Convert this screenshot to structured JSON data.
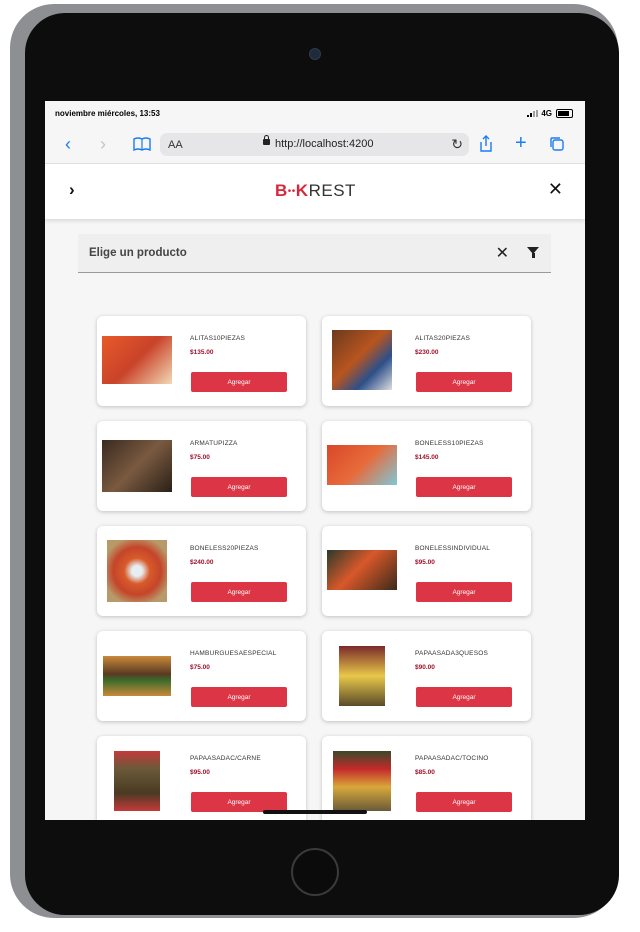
{
  "status": {
    "datetime": "noviembre miércoles, 13:53",
    "network": "4G"
  },
  "browser": {
    "text_size": "AA",
    "url": "http://localhost:4200"
  },
  "app": {
    "logo": {
      "b": "B",
      "dots": "••",
      "k": "K",
      "rest": "REST"
    },
    "search_placeholder": "Elige un producto"
  },
  "products": [
    {
      "name": "ALITAS10PIEZAS",
      "price": "$135.00",
      "button": "Agregar"
    },
    {
      "name": "ALITAS20PIEZAS",
      "price": "$230.00",
      "button": "Agregar"
    },
    {
      "name": "ARMATUPIZZA",
      "price": "$75.00",
      "button": "Agregar"
    },
    {
      "name": "BONELESS10PIEZAS",
      "price": "$145.00",
      "button": "Agregar"
    },
    {
      "name": "BONELESS20PIEZAS",
      "price": "$240.00",
      "button": "Agregar"
    },
    {
      "name": "BONELESSINDIVIDUAL",
      "price": "$95.00",
      "button": "Agregar"
    },
    {
      "name": "HAMBURGUESAESPECIAL",
      "price": "$75.00",
      "button": "Agregar"
    },
    {
      "name": "PAPAASADA3QUESOS",
      "price": "$90.00",
      "button": "Agregar"
    },
    {
      "name": "PAPAASADAC/CARNE",
      "price": "$95.00",
      "button": "Agregar"
    },
    {
      "name": "PAPAASADAC/TOCINO",
      "price": "$85.00",
      "button": "Agregar"
    }
  ],
  "colors": {
    "accent": "#dc3545",
    "price": "#a0122a",
    "brand": "#d6283a"
  }
}
